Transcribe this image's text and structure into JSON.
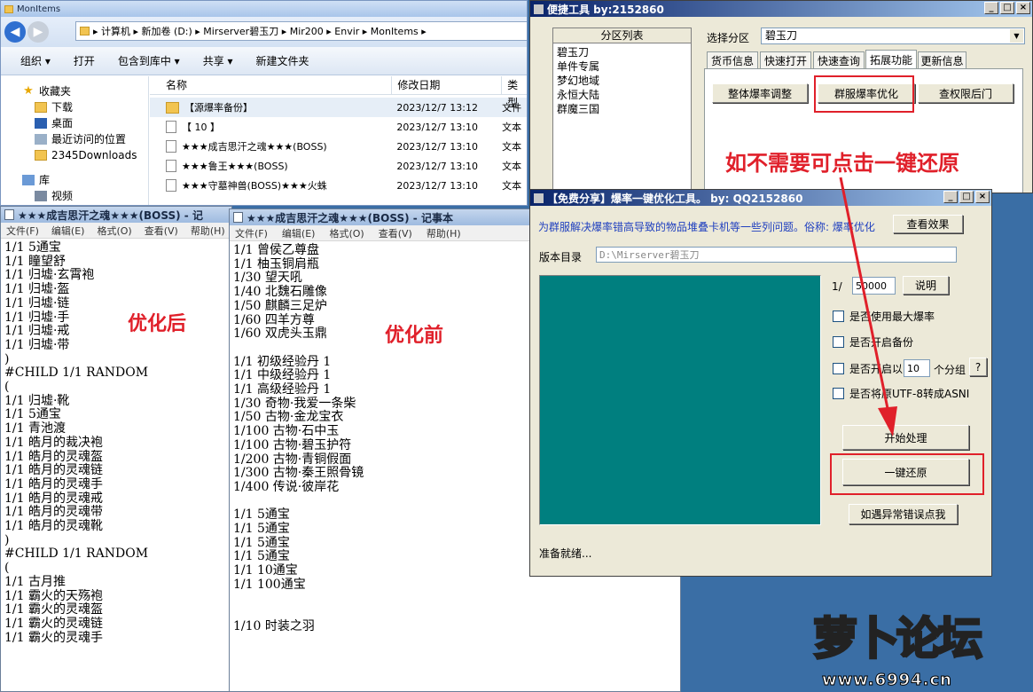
{
  "explorer": {
    "title": "MonItems",
    "address": "▸ 计算机 ▸ 新加卷 (D:) ▸ Mirserver碧玉刀 ▸ Mir200 ▸ Envir ▸ MonItems ▸",
    "toolbar": [
      "组织 ▾",
      "打开",
      "包含到库中 ▾",
      "共享 ▾",
      "新建文件夹"
    ],
    "nav": {
      "favorites": "收藏夹",
      "items": [
        "下载",
        "桌面",
        "最近访问的位置",
        "2345Downloads"
      ],
      "library": "库",
      "library_item": "视频"
    },
    "columns": [
      "名称",
      "修改日期",
      "类型"
    ],
    "files": [
      {
        "name": "【源爆率备份】",
        "date": "2023/12/7 13:12",
        "type": "文件"
      },
      {
        "name": "【   10   】",
        "date": "2023/12/7 13:10",
        "type": "文本"
      },
      {
        "name": "★★★成吉思汗之魂★★★(BOSS)",
        "date": "2023/12/7 13:10",
        "type": "文本"
      },
      {
        "name": "★★★鲁王★★★(BOSS)",
        "date": "2023/12/7 13:10",
        "type": "文本"
      },
      {
        "name": "★★★守墓神兽(BOSS)★★★火蛛",
        "date": "2023/12/7 13:10",
        "type": "文本"
      }
    ]
  },
  "notepad_after": {
    "title": "★★★成吉思汗之魂★★★(BOSS) - 记",
    "menu": [
      "文件(F)",
      "编辑(E)",
      "格式(O)",
      "查看(V)",
      "帮助(H)"
    ],
    "label": "优化后",
    "content": "1/1 5通宝\n1/1 瞳望舒\n1/1 归墟·玄霄袍\n1/1 归墟·盔\n1/1 归墟·链\n1/1 归墟·手\n1/1 归墟·戒\n1/1 归墟·带\n)\n#CHILD 1/1 RANDOM\n(\n1/1 归墟·靴\n1/1 5通宝\n1/1 青池渡\n1/1 皓月的裁决袍\n1/1 皓月的灵魂盔\n1/1 皓月的灵魂链\n1/1 皓月的灵魂手\n1/1 皓月的灵魂戒\n1/1 皓月的灵魂带\n1/1 皓月的灵魂靴\n)\n#CHILD 1/1 RANDOM\n(\n1/1 古月推\n1/1 霸火的天殇袍\n1/1 霸火的灵魂盔\n1/1 霸火的灵魂链\n1/1 霸火的灵魂手"
  },
  "notepad_before": {
    "title": "★★★成吉思汗之魂★★★(BOSS) - 记事本",
    "menu": [
      "文件(F)",
      "编辑(E)",
      "格式(O)",
      "查看(V)",
      "帮助(H)"
    ],
    "label": "优化前",
    "content": "1/1 曾侯乙尊盘\n1/1 柚玉铜肩瓶\n1/30 望天吼\n1/40 北魏石雕像\n1/50 麒麟三足炉\n1/60 四羊方尊\n1/60 双虎头玉鼎\n\n1/1 初级经验丹 1\n1/1 中级经验丹 1\n1/1 高级经验丹 1\n1/30 奇物·我爱一条柴\n1/50 古物·金龙宝衣\n1/100 古物·石中玉\n1/100 古物·碧玉护符\n1/200 古物·青铜假面\n1/300 古物·秦王照骨镜\n1/400 传说·彼岸花\n\n1/1 5通宝\n1/1 5通宝\n1/1 5通宝\n1/1 5通宝\n1/1 10通宝\n1/1 100通宝\n\n\n1/10 时装之羽"
  },
  "quick_tool": {
    "title": "便捷工具   by:2152860",
    "partition_header": "分区列表",
    "partitions": [
      "碧玉刀",
      "单件专属",
      "梦幻地域",
      "永恒大陆",
      "群魔三国"
    ],
    "select_label": "选择分区",
    "select_value": "碧玉刀",
    "tabs": [
      "货币信息",
      "快速打开",
      "快速查询",
      "拓展功能",
      "更新信息"
    ],
    "buttons": [
      "整体爆率调整",
      "群服爆率优化",
      "查权限后门"
    ]
  },
  "annotation": "如不需要可点击一键还原",
  "share_tool": {
    "title": "【免费分享】爆率一键优化工具。   by: QQ2152860",
    "description": "为群服解决爆率错高导致的物品堆叠卡机等一些列问题。俗称: 爆率优化",
    "view_effect": "查看效果",
    "version_label": "版本目录",
    "version_value": "D:\\Mirserver碧玉刀",
    "ratio_prefix": "1/",
    "ratio_value": "50000",
    "explain": "说明",
    "options": [
      "是否使用最大爆率",
      "是否开启备份",
      "是否开启以",
      "是否将原UTF-8转成ASNI"
    ],
    "group_value": "10",
    "group_suffix": "个分组",
    "help": "?",
    "start": "开始处理",
    "restore": "一键还原",
    "error": "如遇异常错误点我",
    "status": "准备就绪..."
  },
  "logo": {
    "text": "萝卜论坛",
    "url": "www.6994.cn"
  }
}
